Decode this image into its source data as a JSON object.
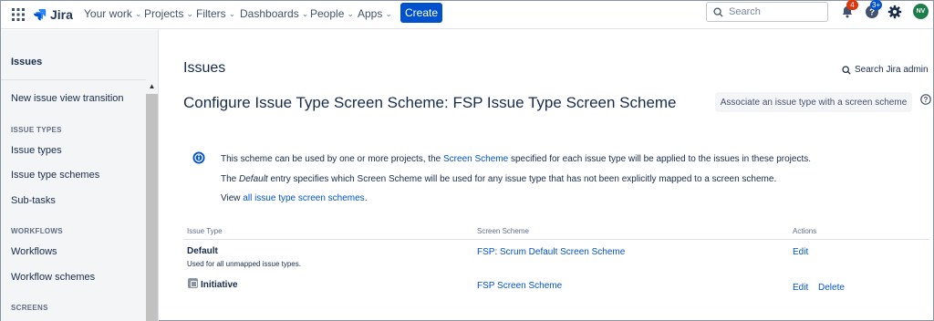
{
  "nav": {
    "logo": "Jira",
    "items": [
      {
        "label": "Your work"
      },
      {
        "label": "Projects"
      },
      {
        "label": "Filters"
      },
      {
        "label": "Dashboards"
      },
      {
        "label": "People"
      },
      {
        "label": "Apps"
      }
    ],
    "create_label": "Create",
    "search_placeholder": "Search",
    "notifications_count": "4",
    "help_count": "3+",
    "avatar_initials": "NV",
    "accent": "#0052cc"
  },
  "sidebar": {
    "title": "Issues",
    "items": {
      "new_view": "New issue view transition",
      "issue_types_head": "ISSUE TYPES",
      "issue_types": "Issue types",
      "issue_type_schemes": "Issue type schemes",
      "subtasks": "Sub-tasks",
      "workflows_head": "WORKFLOWS",
      "workflows": "Workflows",
      "workflow_schemes": "Workflow schemes",
      "screens_head": "SCREENS"
    }
  },
  "main": {
    "page_title": "Issues",
    "search_admin": "Search Jira admin",
    "scheme_title": "Configure Issue Type Screen Scheme: FSP Issue Type Screen Scheme",
    "associate_button": "Associate an issue type with a screen scheme",
    "info": {
      "line1_pre": "This scheme can be used by one or more projects, the ",
      "line1_link": "Screen Scheme",
      "line1_post": " specified for each issue type will be applied to the issues in these projects.",
      "line2_pre": "The ",
      "line2_em": "Default",
      "line2_post": " entry specifies which Screen Scheme will be used for any issue type that has not been explicitly mapped to a screen scheme.",
      "line3_pre": "View ",
      "line3_link": "all issue type screen schemes",
      "line3_post": "."
    },
    "table": {
      "headers": {
        "issue_type": "Issue Type",
        "screen_scheme": "Screen Scheme",
        "actions": "Actions"
      },
      "rows": [
        {
          "name": "Default",
          "sub": "Used for all unmapped issue types.",
          "scheme": "FSP: Scrum Default Screen Scheme",
          "edit": "Edit",
          "delete": ""
        },
        {
          "name": "Initiative",
          "sub": "",
          "scheme": "FSP Screen Scheme",
          "edit": "Edit",
          "delete": "Delete"
        }
      ]
    }
  }
}
